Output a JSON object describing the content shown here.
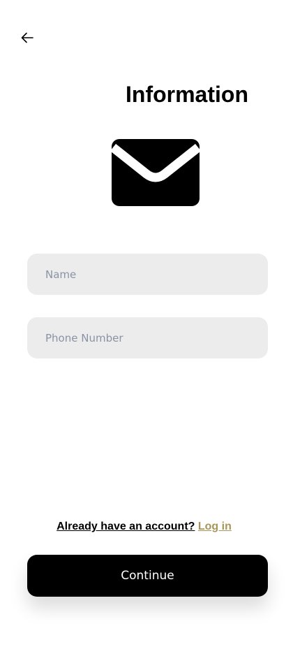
{
  "header": {
    "back_icon": "arrow-left-icon",
    "title": "Information"
  },
  "illustration": {
    "icon": "mail-envelope-icon"
  },
  "form": {
    "name_placeholder": "Name",
    "name_value": "",
    "phone_placeholder": "Phone Number",
    "phone_value": ""
  },
  "footer": {
    "question": "Already have an account?",
    "login_label": "Log in",
    "continue_label": "Continue"
  },
  "colors": {
    "accent": "#a8955a",
    "primary_button": "#000000",
    "field_background": "#ececec",
    "placeholder": "#8a93a6"
  }
}
